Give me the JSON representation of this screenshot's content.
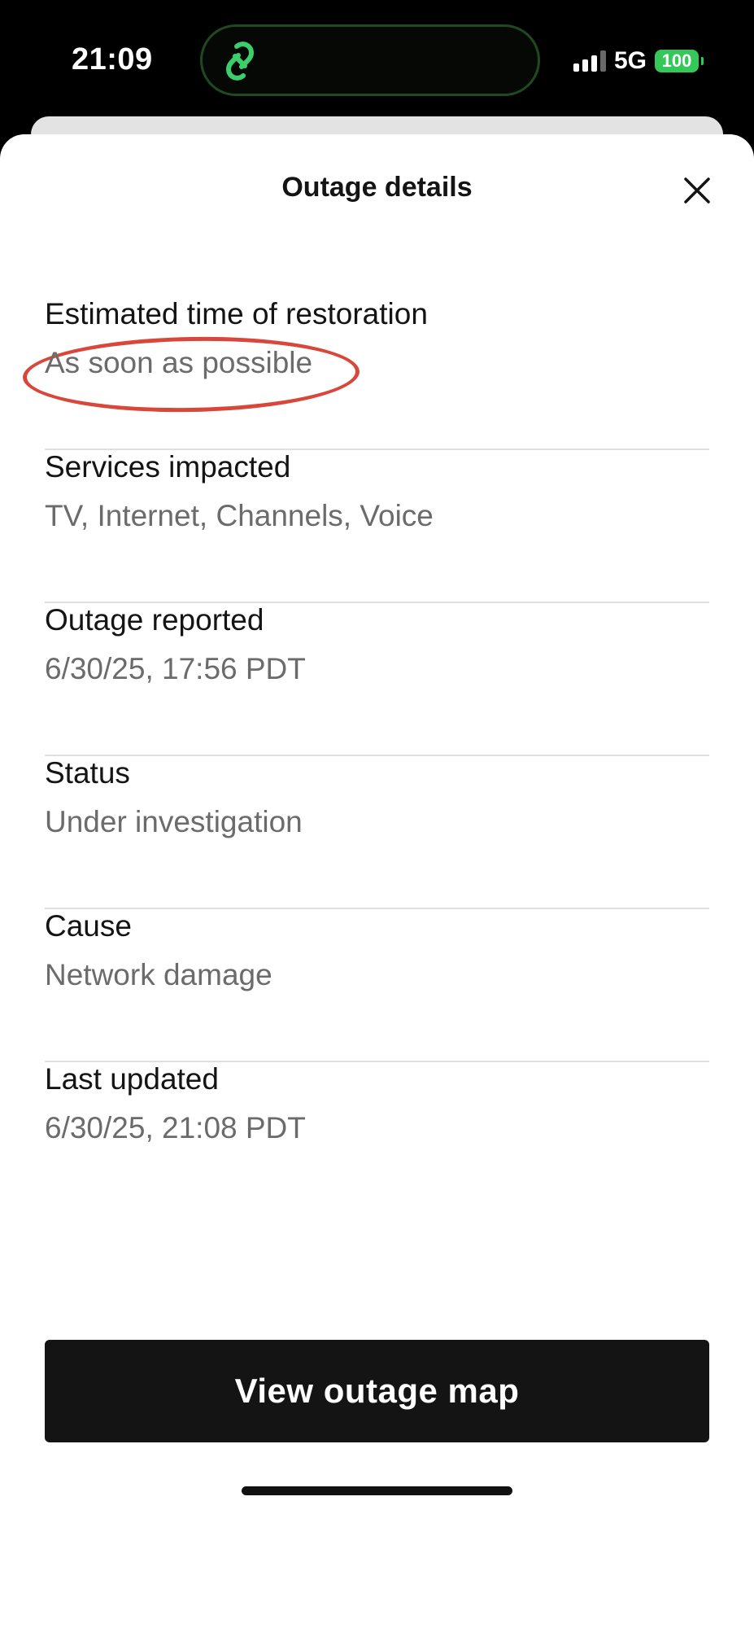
{
  "status_bar": {
    "time": "21:09",
    "network": "5G",
    "battery": "100",
    "icons": {
      "island": "link-chain-icon",
      "signal": "signal-bars-icon",
      "battery": "battery-icon"
    },
    "colors": {
      "island_icon": "#3cce6a",
      "battery_fill": "#34c759"
    }
  },
  "sheet": {
    "title": "Outage details",
    "close_icon": "close-icon",
    "details": [
      {
        "label": "Estimated time of restoration",
        "value": "As soon as possible"
      },
      {
        "label": "Services impacted",
        "value": "TV, Internet, Channels, Voice"
      },
      {
        "label": "Outage reported",
        "value": "6/30/25, 17:56 PDT"
      },
      {
        "label": "Status",
        "value": "Under investigation"
      },
      {
        "label": "Cause",
        "value": "Network damage"
      },
      {
        "label": "Last updated",
        "value": "6/30/25, 21:08 PDT"
      }
    ],
    "annotation_color": "#d9473a",
    "primary_button": "View outage map",
    "button_color": "#141414"
  }
}
